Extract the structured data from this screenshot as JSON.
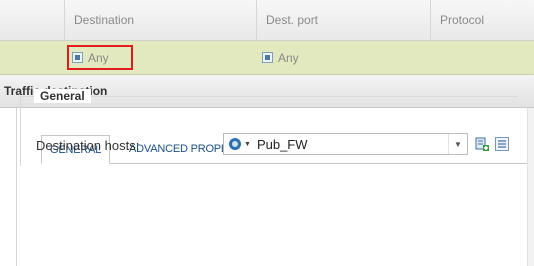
{
  "grid": {
    "columns": [
      "Destination",
      "Dest. port",
      "Protocol"
    ],
    "row": {
      "destination": "Any",
      "dest_port": "Any"
    }
  },
  "panel": {
    "title": "Traffic destination",
    "tabs": [
      "GENERAL",
      "ADVANCED PROPERTIES"
    ],
    "active_tab": "GENERAL",
    "section": {
      "legend": "General",
      "destination_hosts_label": "Destination hosts:",
      "destination_hosts_value": "Pub_FW"
    }
  },
  "colors": {
    "selected_row": "#e3e9bf",
    "highlight_border": "#e01d1d",
    "tab_text": "#1a4f8a"
  },
  "icons": {
    "row_object": "object-icon",
    "host_object": "host-object-icon",
    "add": "add-object-icon",
    "list": "list-icon"
  }
}
